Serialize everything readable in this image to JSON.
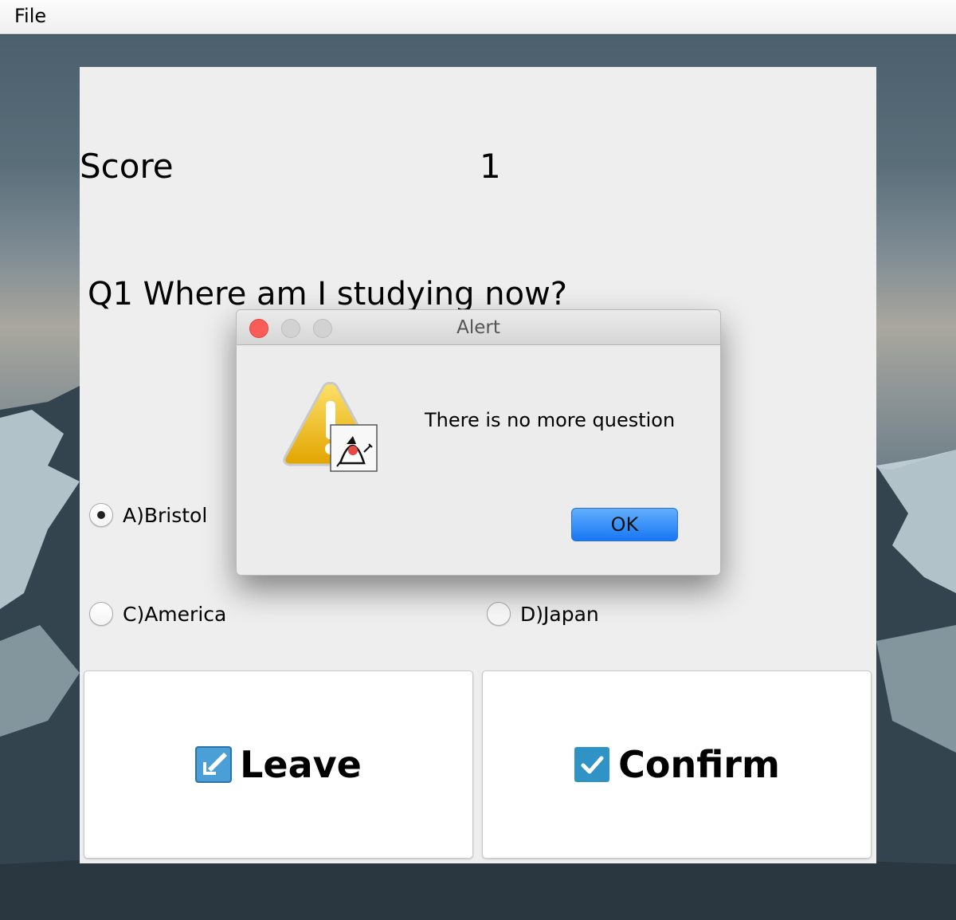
{
  "menubar": {
    "file_label": "File"
  },
  "panel": {
    "score_label": "Score",
    "score_value": "1",
    "question": "Q1 Where am I studying now?",
    "options": {
      "a": {
        "label": "A)Bristol",
        "selected": true
      },
      "c": {
        "label": "C)America",
        "selected": false
      },
      "d": {
        "label": "D)Japan",
        "selected": false
      }
    },
    "leave_button": {
      "label": "Leave",
      "icon": "leave-arrow-icon"
    },
    "confirm_button": {
      "label": "Confirm",
      "icon": "checkmark-icon"
    }
  },
  "dialog": {
    "title": "Alert",
    "message": "There is no more question",
    "ok_label": "OK",
    "icon": "warning-java-icon"
  },
  "colors": {
    "ok_button": "#1677f5",
    "close_light": "#fc5c57",
    "panel_bg": "#eeeeee"
  }
}
